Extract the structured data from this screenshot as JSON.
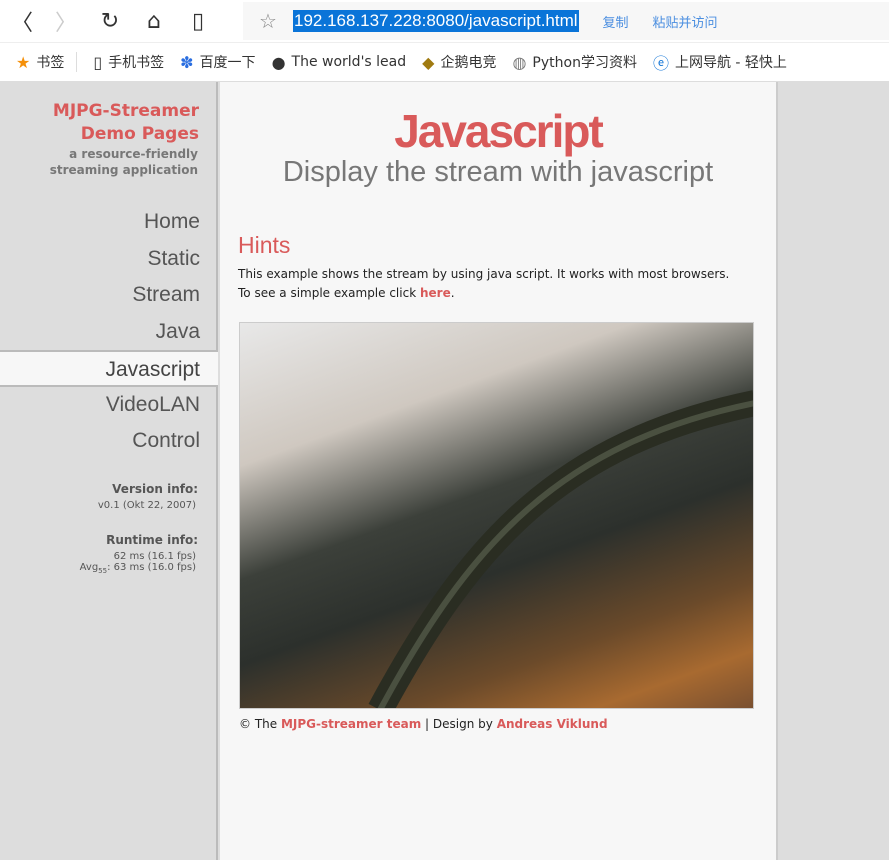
{
  "browser": {
    "url": "192.168.137.228:8080/javascript.html",
    "copy": "复制",
    "paste_go": "粘贴并访问",
    "bookmarks": [
      {
        "icon": "star-icon",
        "label": "书签"
      },
      {
        "icon": "phone-icon",
        "label": "手机书签"
      },
      {
        "icon": "baidu-paw-icon",
        "label": "百度一下"
      },
      {
        "icon": "github-icon",
        "label": "The world's lead"
      },
      {
        "icon": "game-icon",
        "label": "企鹅电竞"
      },
      {
        "icon": "globe-icon",
        "label": "Python学习资料"
      },
      {
        "icon": "ie-icon",
        "label": "上网导航 - 轻快上"
      }
    ]
  },
  "sidebar": {
    "logo_title": "MJPG-Streamer Demo Pages",
    "logo_sub": "a resource-friendly streaming application",
    "items": [
      {
        "label": "Home"
      },
      {
        "label": "Static"
      },
      {
        "label": "Stream"
      },
      {
        "label": "Java"
      },
      {
        "label": "Javascript",
        "active": true
      },
      {
        "label": "VideoLAN"
      },
      {
        "label": "Control"
      }
    ],
    "version_head": "Version info:",
    "version": "v0.1 (Okt 22, 2007)",
    "runtime_head": "Runtime info:",
    "runtime1": "62 ms (16.1 fps)",
    "avg": "Avg",
    "avg_sub": "55",
    "runtime2": ": 63 ms (16.0 fps)"
  },
  "main": {
    "title": "Javascript",
    "subtitle": "Display the stream with javascript",
    "hints": "Hints",
    "p1": "This example shows the stream by using java script. It works with most browsers.",
    "p2a": "To see a simple example click ",
    "p2link": "here",
    "p2b": ".",
    "foot_a": "© The ",
    "foot_link1": "MJPG-streamer team",
    "foot_b": " | Design by ",
    "foot_link2": "Andreas Viklund"
  },
  "colors": {
    "accent": "#d95a5a",
    "selection": "#0a74d8"
  }
}
